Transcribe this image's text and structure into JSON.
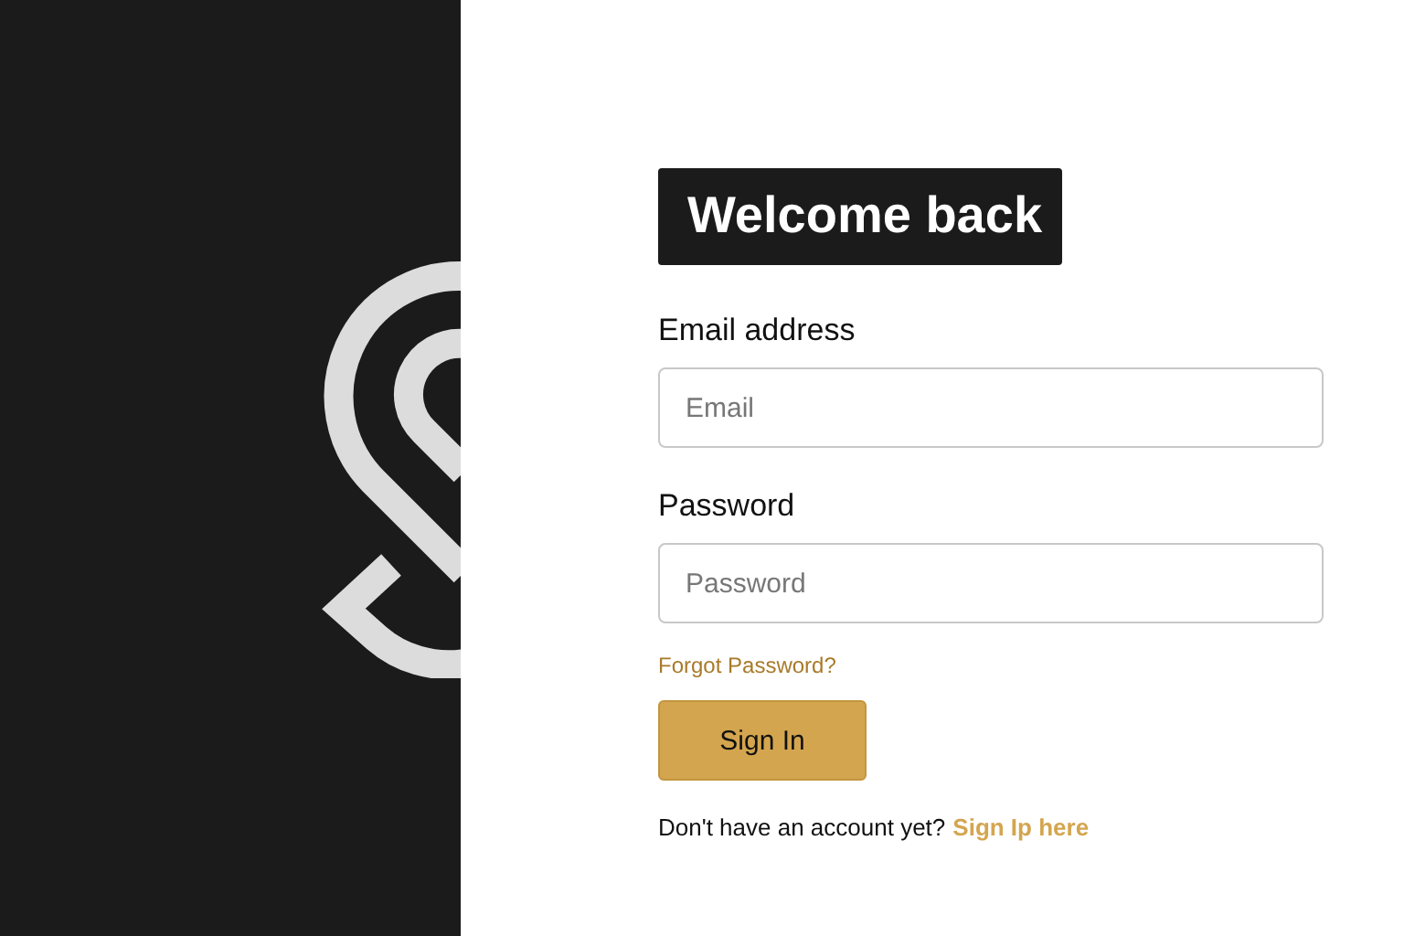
{
  "heading": "Welcome back",
  "fields": [
    {
      "label": "Email address",
      "placeholder": "Email"
    },
    {
      "label": "Password",
      "placeholder": "Password"
    }
  ],
  "forgot_link": "Forgot Password?",
  "submit_button": "Sign In",
  "signup": {
    "text": "Don't have an account yet?",
    "link": "Sign Ip here"
  }
}
